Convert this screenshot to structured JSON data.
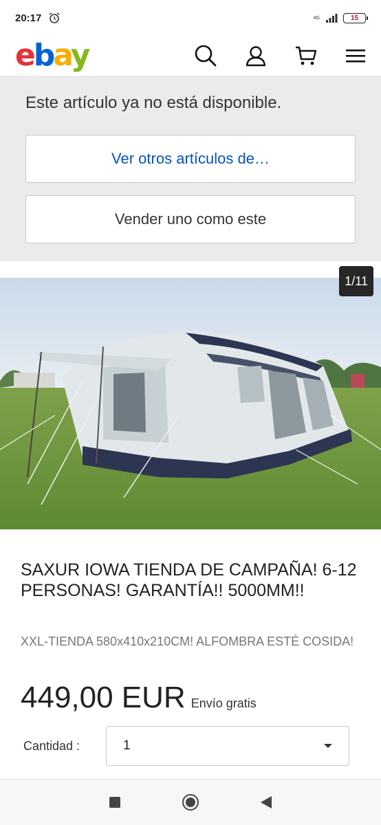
{
  "status_bar": {
    "time": "20:17",
    "network": "4G",
    "battery": "15",
    "battery_color": "#c0171c"
  },
  "header": {
    "logo": {
      "e": "e",
      "b": "b",
      "a": "a",
      "y": "y"
    },
    "icons": [
      "search-icon",
      "user-icon",
      "cart-icon",
      "menu-icon"
    ]
  },
  "unavailable": {
    "message": "Este artículo ya no está disponible.",
    "other_items_label": "Ver otros artículos de…",
    "sell_label": "Vender uno como este"
  },
  "gallery": {
    "counter": "1/11"
  },
  "product": {
    "title": "SAXUR IOWA TIENDA DE CAMPAÑA! 6-12 PERSONAS! GARANTÍA!! 5000MM!!",
    "subtitle": "XXL-TIENDA 580x410x210CM! ALFOMBRA ESTÉ COSIDA!",
    "price": "449,00 EUR",
    "shipping": "Envío gratis",
    "quantity_label": "Cantidad :",
    "quantity_value": "1"
  },
  "colors": {
    "link_blue": "#0654ba",
    "banner_bg": "#ebebeb"
  }
}
